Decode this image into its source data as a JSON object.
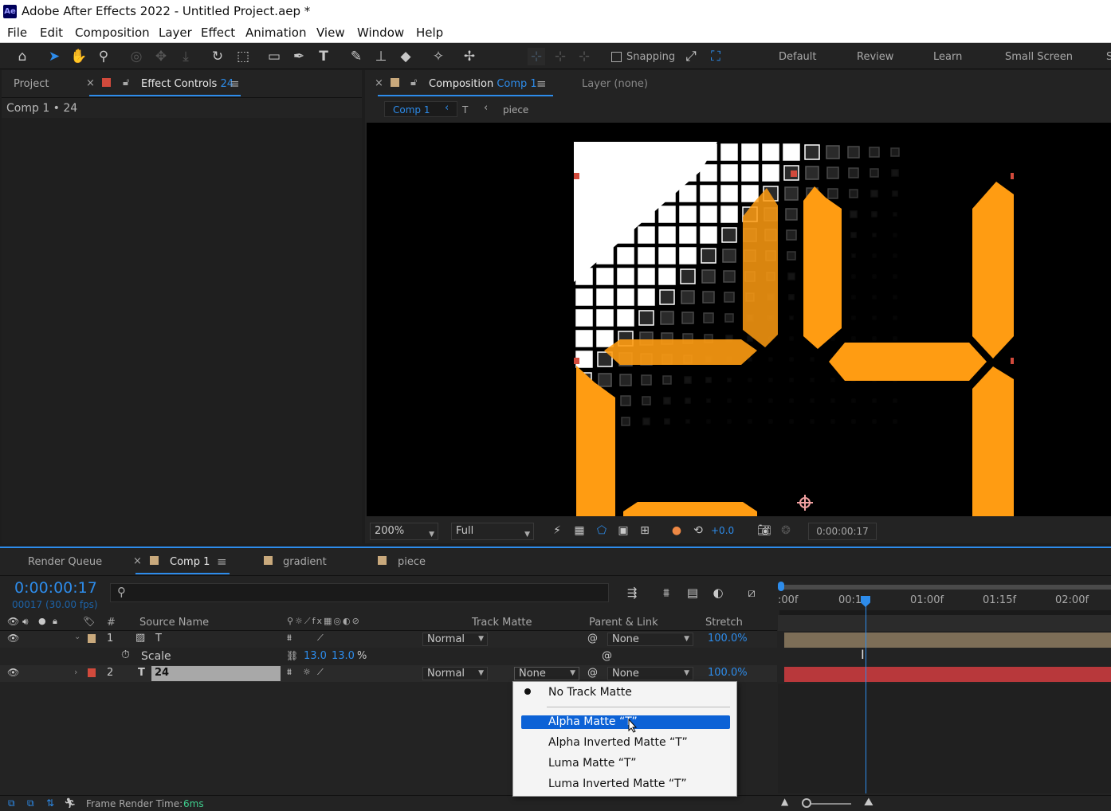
{
  "app": {
    "title": "Adobe After Effects 2022 - Untitled Project.aep *",
    "logo": "Ae"
  },
  "menu": [
    "File",
    "Edit",
    "Composition",
    "Layer",
    "Effect",
    "Animation",
    "View",
    "Window",
    "Help"
  ],
  "toolbar": {
    "snapping": "Snapping",
    "workspaces": [
      "Default",
      "Review",
      "Learn",
      "Small Screen"
    ],
    "more": "S"
  },
  "left_panel": {
    "project_tab": "Project",
    "effect_tab": "Effect Controls",
    "effect_tab_num": "24",
    "header": "Comp 1 • 24"
  },
  "comp_panel": {
    "tab": "Composition",
    "tab_comp": "Comp 1",
    "layer_tab": "Layer (none)",
    "breadcrumb": [
      "Comp 1",
      "T",
      "piece"
    ],
    "zoom": "200%",
    "resolution": "Full",
    "exposure": "+0.0",
    "timecode": "0:00:00:17"
  },
  "timeline": {
    "tabs": [
      "Render Queue",
      "Comp 1",
      "gradient",
      "piece"
    ],
    "timecode": "0:00:00:17",
    "frame_info": "00017 (30.00 fps)",
    "columns": {
      "source_name": "Source Name",
      "track_matte": "Track Matte",
      "parent": "Parent & Link",
      "stretch": "Stretch",
      "num": "#"
    },
    "ruler": [
      ":00f",
      "00:1",
      "01:00f",
      "01:15f",
      "02:00f"
    ],
    "layers": [
      {
        "num": "1",
        "name": "T",
        "mode": "Normal",
        "parent": "None",
        "stretch": "100.0%",
        "color": "#c9a97c"
      },
      {
        "num": "2",
        "name": "24",
        "mode": "Normal",
        "matte": "None",
        "parent": "None",
        "stretch": "100.0%",
        "color": "#d24a3c"
      }
    ],
    "scale": {
      "label": "Scale",
      "x": "13.0",
      "y": "13.0",
      "unit": "%"
    },
    "footer": {
      "label": "Frame Render Time:",
      "value": "6ms"
    }
  },
  "dropdown": {
    "items": [
      "No Track Matte",
      "Alpha Matte “T”",
      "Alpha Inverted Matte “T”",
      "Luma Matte “T”",
      "Luma Inverted Matte “T”"
    ],
    "selected_index": 1,
    "checked_index": 0
  },
  "colors": {
    "accent": "#2d8ceb",
    "highlight": "#0c62d6",
    "orange": "#ff9c12",
    "layer2_bar": "#b8383b",
    "layer1_bar": "#7d6e57"
  }
}
